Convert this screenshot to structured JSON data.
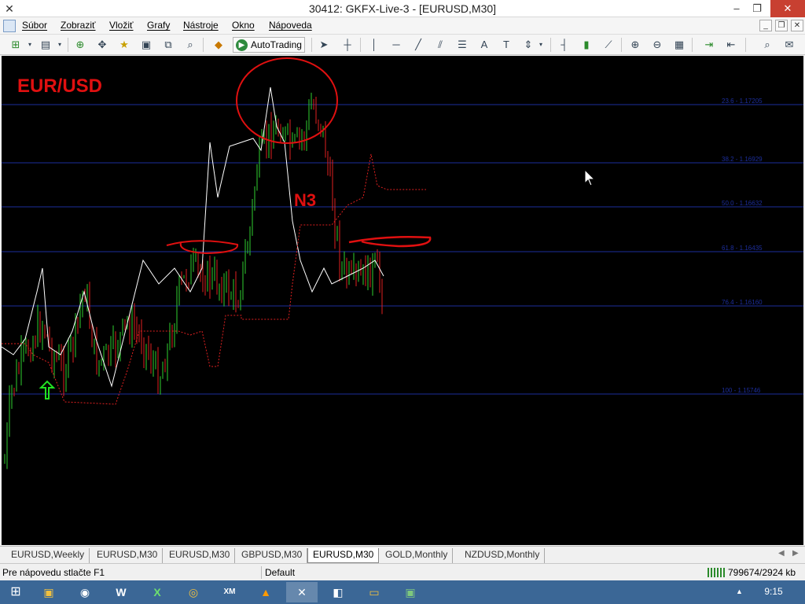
{
  "window": {
    "title": "30412: GKFX-Live-3 - [EURUSD,M30]",
    "minimize": "–",
    "restore": "❐",
    "close": "✕"
  },
  "menu": {
    "items": [
      "Súbor",
      "Zobraziť",
      "Vložiť",
      "Grafy",
      "Nástroje",
      "Okno",
      "Nápoveda"
    ]
  },
  "toolbar": {
    "autotrading_label": "AutoTrading"
  },
  "chart": {
    "annotation_symbol": "EUR/USD",
    "annotation_n3": "N3",
    "fib_labels": [
      "23.6 - 1.17205",
      "38.2 - 1.16929",
      "50.0 - 1.16632",
      "61.8 - 1.16435",
      "76.4 - 1.16160",
      "100 - 1.15746"
    ],
    "colors": {
      "background": "#000000",
      "bull": "#2fd02f",
      "bear": "#e02020",
      "ma": "#ffffff",
      "stop_line": "#e02020",
      "fib": "#1c2e9c",
      "annotation": "#e01010"
    }
  },
  "tabs": [
    "EURUSD,Weekly",
    "EURUSD,M30",
    "EURUSD,M30",
    "GBPUSD,M30",
    "EURUSD,M30",
    "GOLD,Monthly",
    "NZDUSD,Monthly"
  ],
  "active_tab_index": 4,
  "status": {
    "help": "Pre nápovedu stlačte F1",
    "profile": "Default",
    "traffic": "799674/2924 kb"
  },
  "taskbar": {
    "clock": "9:15"
  }
}
